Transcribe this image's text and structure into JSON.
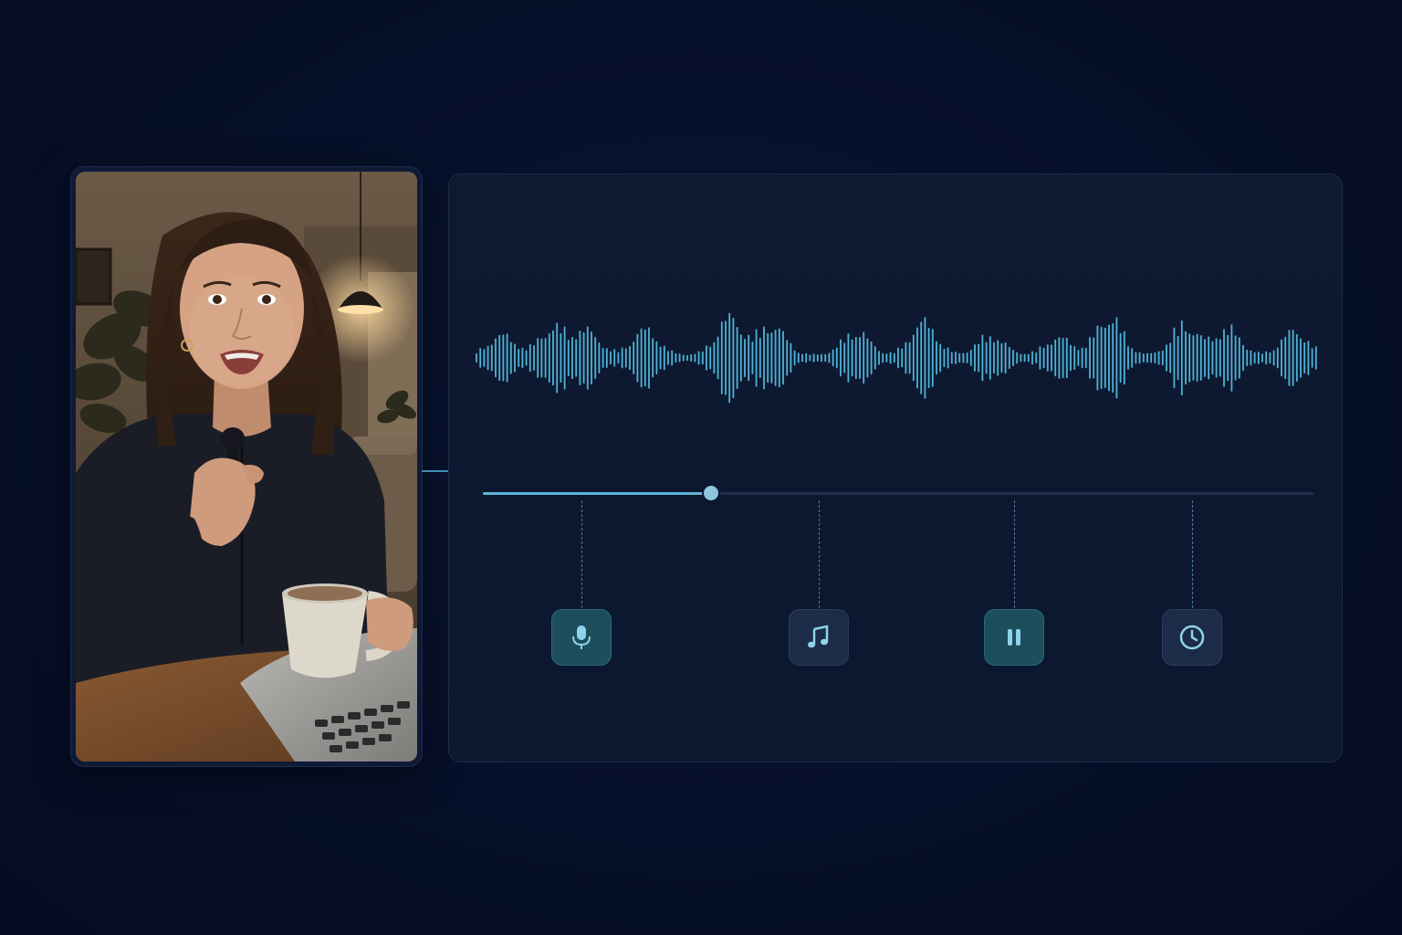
{
  "video": {
    "subject": "person-speaking-into-lavalier-microphone-holding-mug"
  },
  "playback": {
    "progress": 0.275
  },
  "waveform": {
    "color": "#4fb3d6"
  },
  "markers": [
    {
      "name": "mic-marker",
      "icon": "microphone-icon",
      "position": 0.119,
      "style": "teal"
    },
    {
      "name": "music-marker",
      "icon": "music-note-icon",
      "position": 0.404,
      "style": "slate"
    },
    {
      "name": "pause-marker",
      "icon": "pause-icon",
      "position": 0.64,
      "style": "teal"
    },
    {
      "name": "clock-marker",
      "icon": "clock-icon",
      "position": 0.854,
      "style": "slate"
    }
  ],
  "colors": {
    "background": "#07102a",
    "panel": "#0e1a31",
    "accent": "#5fb5d6",
    "icon": "#8fd3ea"
  }
}
